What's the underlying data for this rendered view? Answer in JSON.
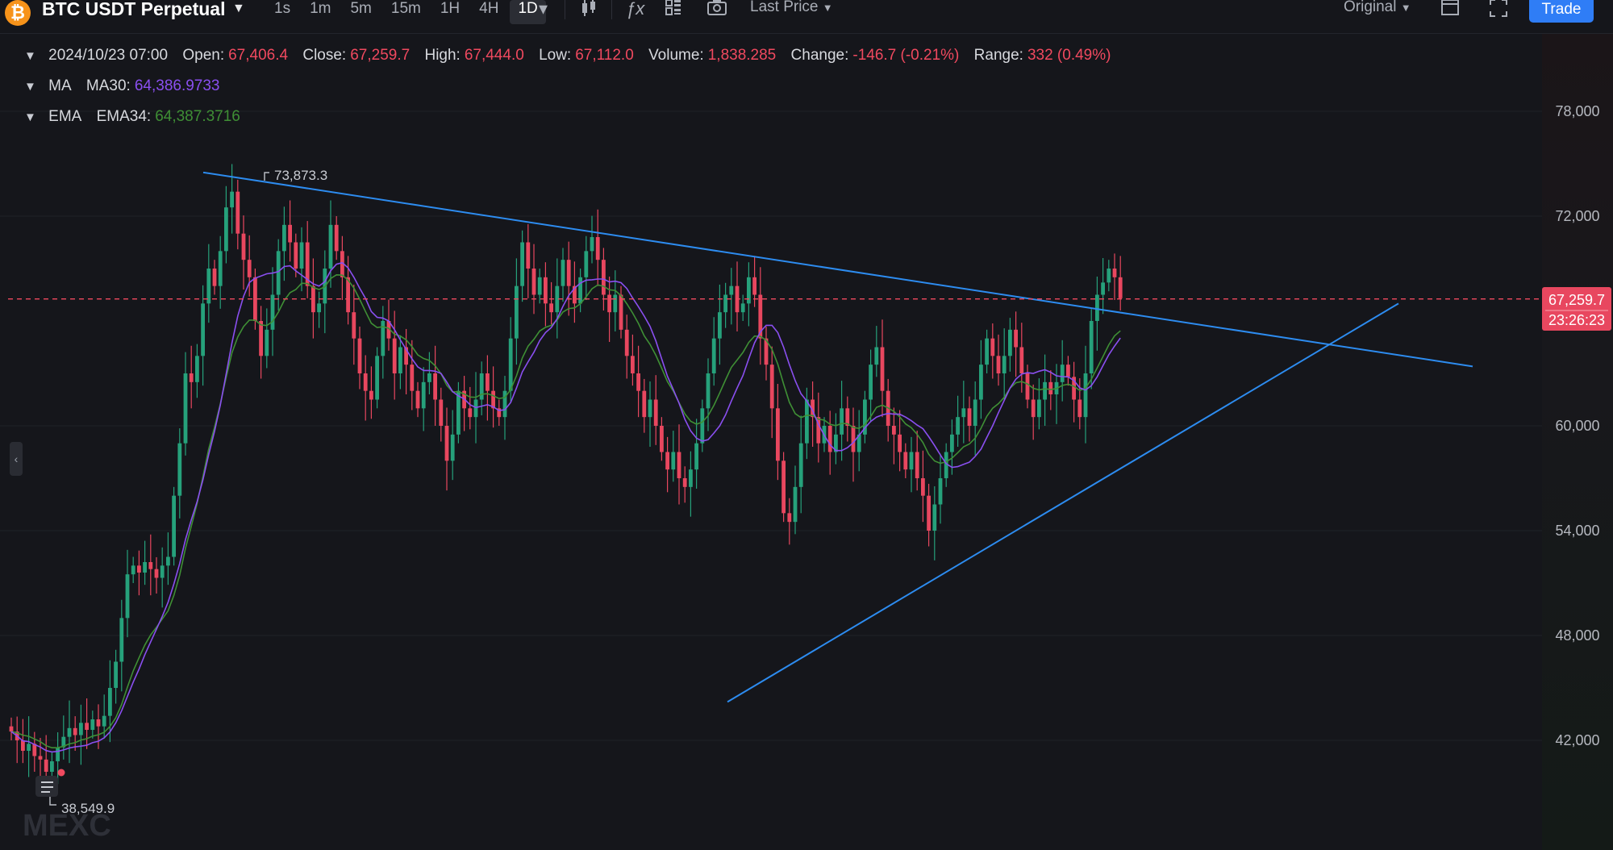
{
  "toolbar": {
    "coin_icon": "bitcoin-icon",
    "symbol": "BTC USDT Perpetual",
    "intervals": [
      "1s",
      "1m",
      "5m",
      "15m",
      "1H",
      "4H",
      "1D"
    ],
    "active_interval": "1D",
    "icons": [
      "chevron-down-icon",
      "candlestick-icon",
      "indicator-icon",
      "layout-icon",
      "camera-icon",
      "window-icon",
      "fullscreen-icon"
    ],
    "price_type": "Last Price",
    "view_mode": "Original",
    "trade_label": "Trade"
  },
  "legend": {
    "ohlc": {
      "date": "2024/10/23 07:00",
      "open_label": "Open:",
      "open": "67,406.4",
      "close_label": "Close:",
      "close": "67,259.7",
      "high_label": "High:",
      "high": "67,444.0",
      "low_label": "Low:",
      "low": "67,112.0",
      "volume_label": "Volume:",
      "volume": "1,838.285",
      "change_label": "Change:",
      "change": "-146.7 (-0.21%)",
      "range_label": "Range:",
      "range": "332 (0.49%)"
    },
    "ma": {
      "group": "MA",
      "label": "MA30:",
      "value": "64,386.9733"
    },
    "ema": {
      "group": "EMA",
      "label": "EMA34:",
      "value": "64,387.3716"
    }
  },
  "price_axis": {
    "ticks": [
      "78,000",
      "72,000",
      "60,000",
      "54,000",
      "48,000",
      "42,000"
    ],
    "current_price": "67,259.7",
    "countdown": "23:26:23"
  },
  "annotations": {
    "high_marker": "73,873.3",
    "low_marker": "38,549.9"
  },
  "watermark": "MEXC",
  "colors": {
    "up": "#26a17b",
    "down": "#e8475f",
    "trendline": "#2d8cf0",
    "ma30": "#8a4ff0",
    "ema34": "#3f8f35",
    "current_price": "#f0495f",
    "accent": "#2f7df6"
  },
  "chart_data": {
    "type": "candlestick",
    "price_axis_ticks": [
      42000,
      48000,
      54000,
      60000,
      72000,
      78000
    ],
    "current_price": 67259.7,
    "high_annotation": 73873.3,
    "low_annotation": 38549.9,
    "ma30_last": 64386.9733,
    "ema34_last": 64387.3716,
    "trendlines": [
      {
        "name": "descending resistance",
        "from": [
          0,
          74500
        ],
        "to": [
          180,
          63400
        ]
      },
      {
        "name": "ascending support",
        "from": [
          87,
          44200
        ],
        "to": [
          172,
          67000
        ]
      }
    ],
    "candles_close": [
      42500,
      42000,
      41400,
      41800,
      41100,
      40900,
      40200,
      40800,
      41600,
      42200,
      42700,
      42300,
      43000,
      42600,
      43200,
      42800,
      43400,
      45000,
      46500,
      49000,
      51500,
      52000,
      51600,
      52200,
      51800,
      51300,
      52000,
      52500,
      56000,
      59000,
      63000,
      62500,
      64000,
      67000,
      69000,
      68000,
      70000,
      72500,
      73400,
      71000,
      69500,
      68500,
      66000,
      64000,
      65500,
      67500,
      70000,
      71500,
      70500,
      69000,
      70500,
      68000,
      66500,
      67000,
      69000,
      71500,
      70000,
      68500,
      66500,
      65000,
      63000,
      62000,
      61500,
      64000,
      66000,
      65000,
      63000,
      64500,
      63500,
      62000,
      61000,
      62500,
      63000,
      61500,
      60000,
      58000,
      59500,
      62000,
      61000,
      60500,
      61500,
      63000,
      62000,
      61000,
      60500,
      62000,
      65000,
      68000,
      70500,
      69000,
      67500,
      68500,
      67000,
      66500,
      68000,
      69500,
      68000,
      67000,
      68500,
      70000,
      70800,
      69500,
      67500,
      66500,
      67500,
      65500,
      64000,
      63000,
      62000,
      60500,
      61500,
      60000,
      58500,
      57500,
      58500,
      57000,
      56500,
      57500,
      59000,
      61000,
      63000,
      65000,
      66500,
      67500,
      68000,
      66500,
      67000,
      68500,
      67500,
      65000,
      63500,
      61000,
      58000,
      55000,
      54500,
      56500,
      59000,
      61500,
      60500,
      59000,
      60000,
      58500,
      59500,
      61000,
      60000,
      58500,
      59500,
      61500,
      63500,
      64500,
      62000,
      60000,
      59500,
      58500,
      57500,
      58500,
      57000,
      56000,
      54000,
      55500,
      57000,
      58500,
      59500,
      60500,
      61000,
      60000,
      61500,
      63500,
      65000,
      64000,
      63000,
      64000,
      65500,
      64500,
      63000,
      61500,
      60500,
      61500,
      62500,
      61800,
      62500,
      63500,
      62800,
      61500,
      60500,
      63000,
      66000,
      67500,
      68200,
      69000,
      68500,
      67300
    ]
  }
}
